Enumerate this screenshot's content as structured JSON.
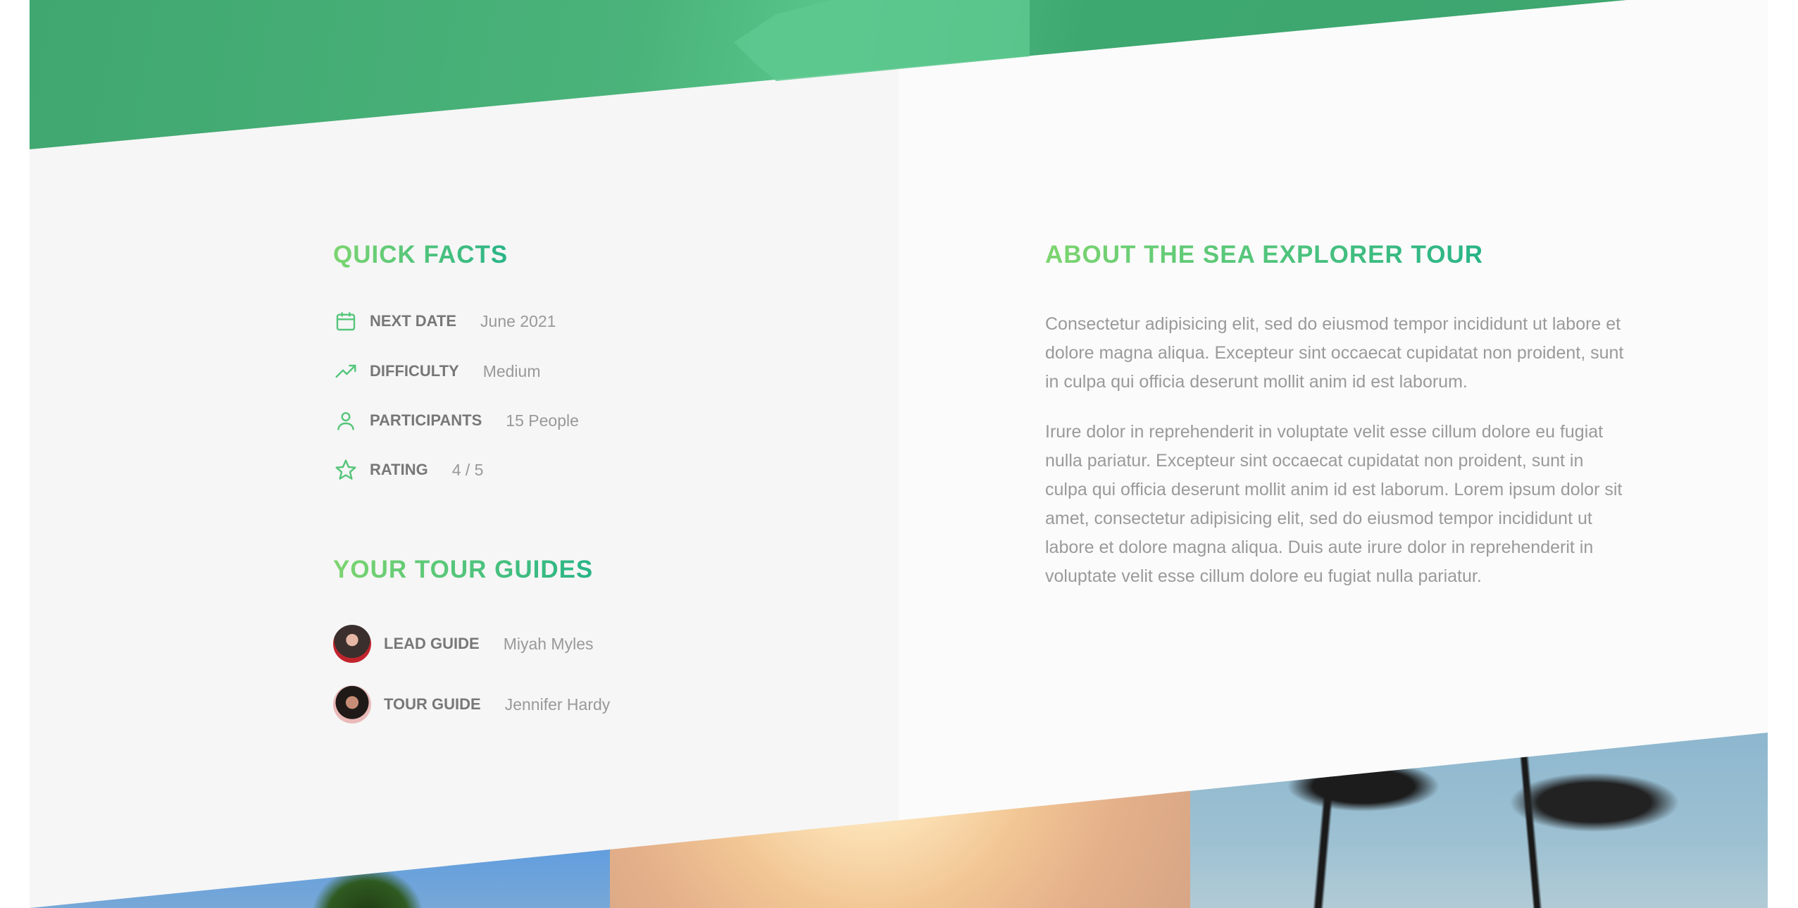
{
  "quick_facts": {
    "heading": "QUICK FACTS",
    "items": [
      {
        "icon": "calendar-icon",
        "label": "NEXT DATE",
        "value": "June 2021"
      },
      {
        "icon": "trending-up-icon",
        "label": "DIFFICULTY",
        "value": "Medium"
      },
      {
        "icon": "user-icon",
        "label": "PARTICIPANTS",
        "value": "15 People"
      },
      {
        "icon": "star-icon",
        "label": "RATING",
        "value": "4 / 5"
      }
    ]
  },
  "tour_guides": {
    "heading": "YOUR TOUR GUIDES",
    "items": [
      {
        "role": "LEAD GUIDE",
        "name": "Miyah Myles"
      },
      {
        "role": "TOUR GUIDE",
        "name": "Jennifer Hardy"
      }
    ]
  },
  "about": {
    "heading": "ABOUT THE SEA EXPLORER TOUR",
    "paragraphs": [
      "Consectetur adipisicing elit, sed do eiusmod tempor incididunt ut labore et dolore magna aliqua. Excepteur sint occaecat cupidatat non proident, sunt in culpa qui officia deserunt mollit anim id est laborum.",
      "Irure dolor in reprehenderit in voluptate velit esse cillum dolore eu fugiat nulla pariatur. Excepteur sint occaecat cupidatat non proident, sunt in culpa qui officia deserunt mollit anim id est laborum. Lorem ipsum dolor sit amet, consectetur adipisicing elit, sed do eiusmod tempor incididunt ut labore et dolore magna aliqua. Duis aute irure dolor in reprehenderit in voluptate velit esse cillum dolore eu fugiat nulla pariatur."
    ]
  },
  "colors": {
    "accent_light": "#7dd56f",
    "accent_dark": "#28b487",
    "label": "#777777",
    "value": "#999999"
  }
}
